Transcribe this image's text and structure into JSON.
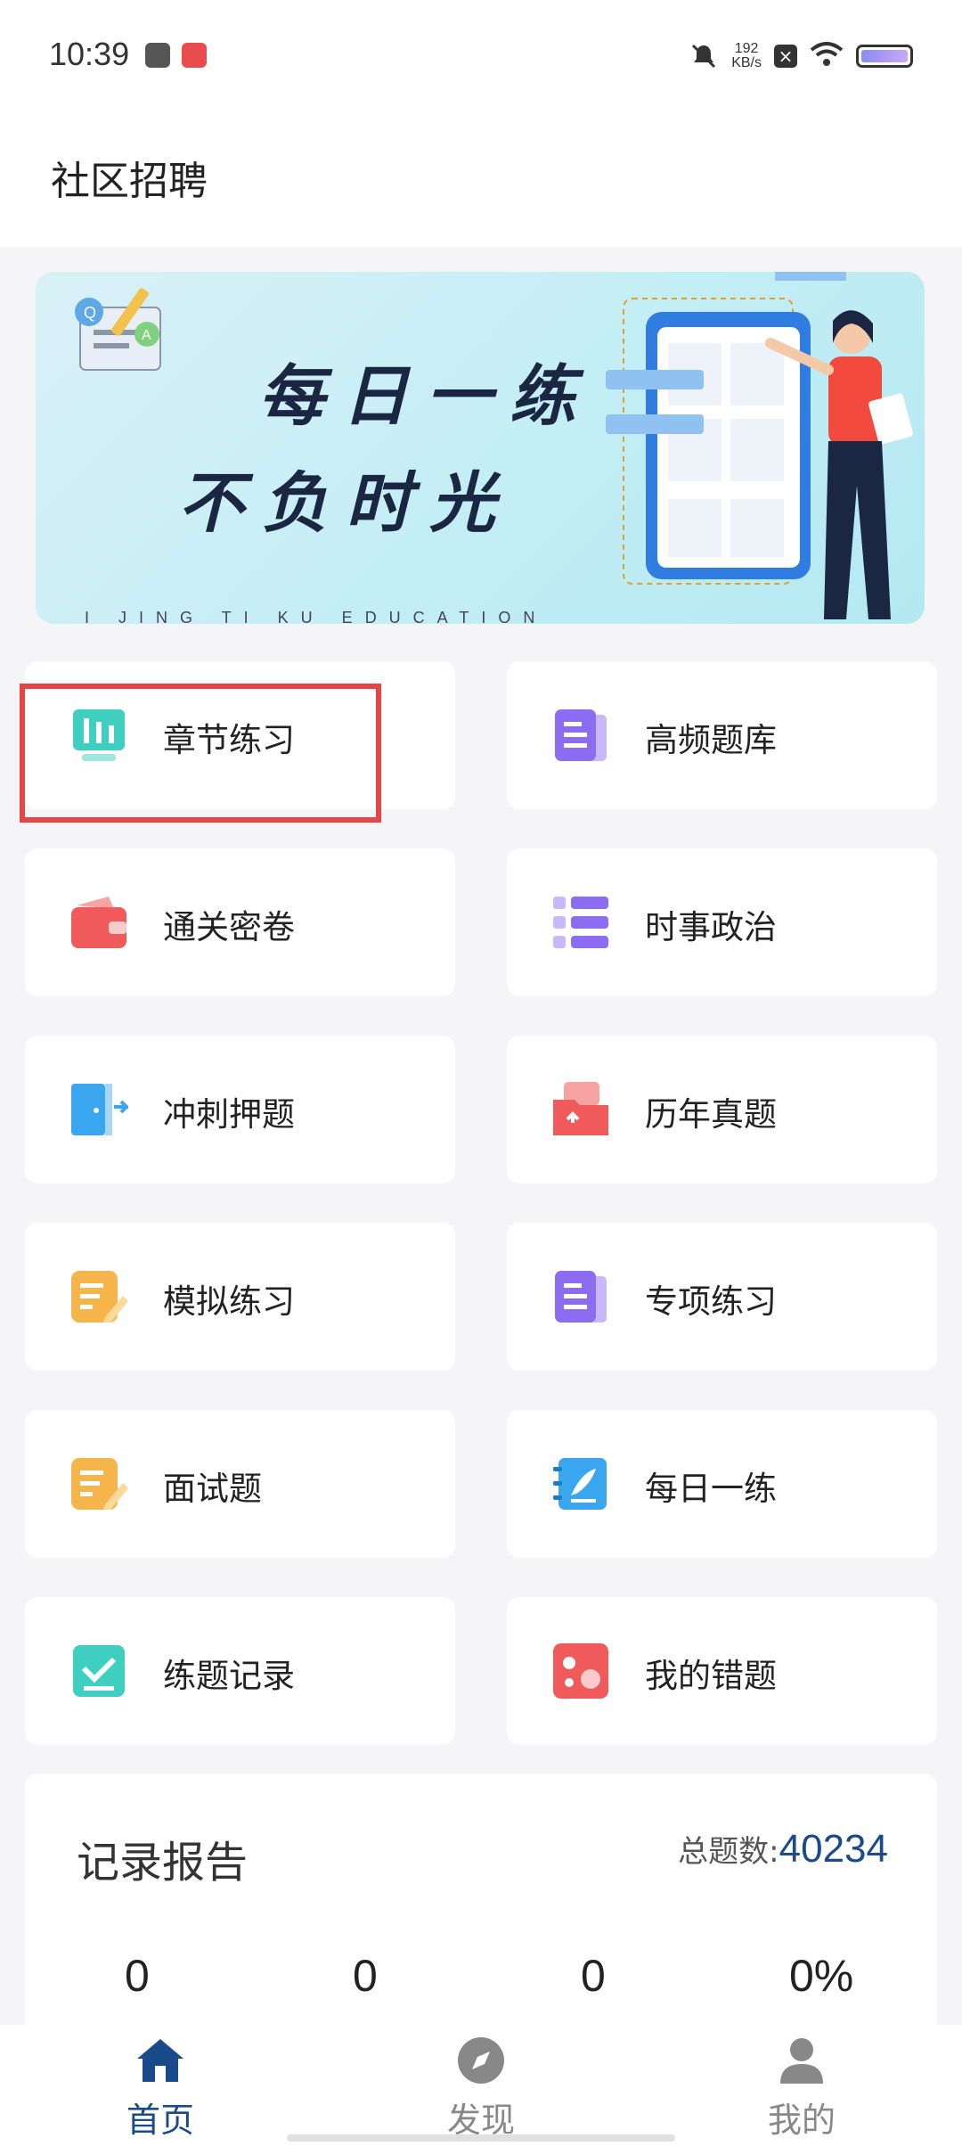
{
  "status_bar": {
    "time": "10:39",
    "speed_value": "192",
    "speed_unit": "KB/s",
    "icons": [
      "app-icon",
      "app-icon",
      "mute-icon",
      "close-notification-icon",
      "wifi-icon",
      "battery-icon"
    ]
  },
  "header": {
    "title": "社区招聘"
  },
  "banner": {
    "line1": "每日一练",
    "line2": "不负时光",
    "subtitle": "I JING TI KU EDUCATION"
  },
  "menu": [
    {
      "label": "章节练习",
      "icon": "chart-bars-icon",
      "color": "#3fcfc0"
    },
    {
      "label": "高频题库",
      "icon": "document-icon",
      "color": "#8c6cf0"
    },
    {
      "label": "通关密卷",
      "icon": "wallet-icon",
      "color": "#f05a5a"
    },
    {
      "label": "时事政治",
      "icon": "list-icon",
      "color": "#8c6cf0"
    },
    {
      "label": "冲刺押题",
      "icon": "door-icon",
      "color": "#3aa6f0"
    },
    {
      "label": "历年真题",
      "icon": "folder-upload-icon",
      "color": "#f05a5a"
    },
    {
      "label": "模拟练习",
      "icon": "edit-document-icon",
      "color": "#f6b54a"
    },
    {
      "label": "专项练习",
      "icon": "document-icon",
      "color": "#8c6cf0"
    },
    {
      "label": "面试题",
      "icon": "edit-document-icon",
      "color": "#f6b54a"
    },
    {
      "label": "每日一练",
      "icon": "notebook-pen-icon",
      "color": "#3aa6f0"
    },
    {
      "label": "练题记录",
      "icon": "checkmark-icon",
      "color": "#3fcfc0"
    },
    {
      "label": "我的错题",
      "icon": "error-dots-icon",
      "color": "#f05a5a"
    }
  ],
  "report": {
    "title": "记录报告",
    "total_label": "总题数:",
    "total_value": "40234",
    "stats": [
      "0",
      "0",
      "0",
      "0%"
    ]
  },
  "tabs": [
    {
      "label": "首页",
      "icon": "home-icon",
      "active": true,
      "color": "#1a4a8a"
    },
    {
      "label": "发现",
      "icon": "compass-icon",
      "active": false,
      "color": "#888888"
    },
    {
      "label": "我的",
      "icon": "user-icon",
      "active": false,
      "color": "#888888"
    }
  ]
}
